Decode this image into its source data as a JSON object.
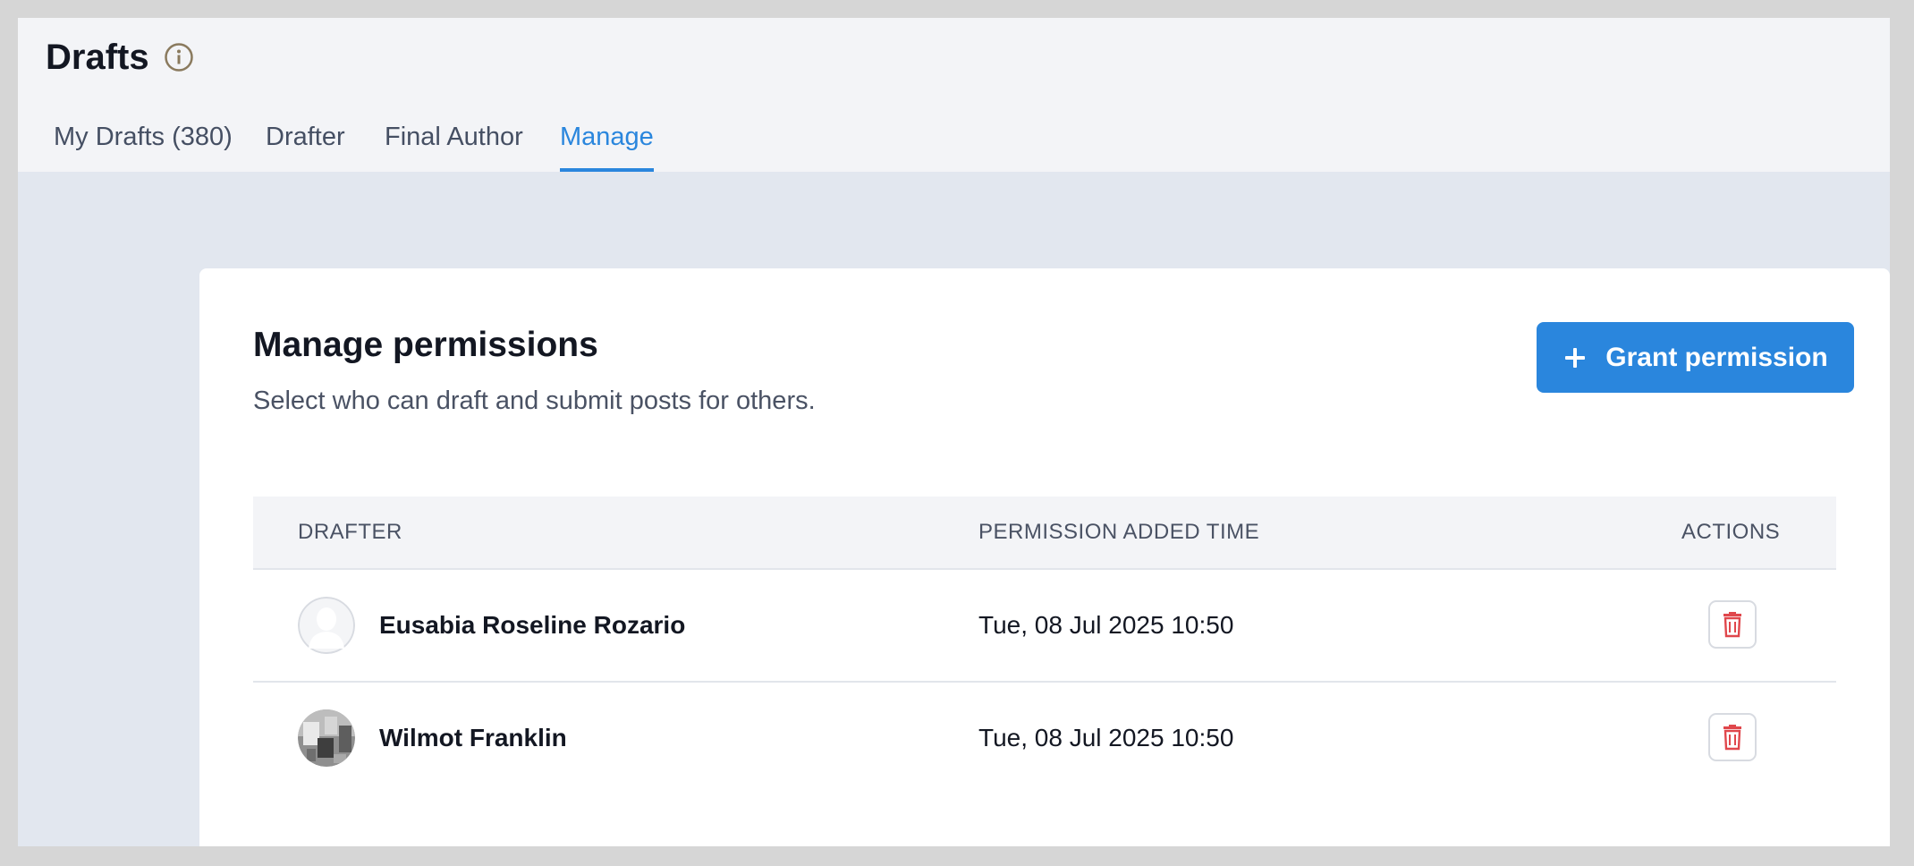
{
  "header": {
    "title": "Drafts",
    "tabs": [
      {
        "label": "My Drafts (380)",
        "active": false
      },
      {
        "label": "Drafter",
        "active": false
      },
      {
        "label": "Final Author",
        "active": false
      },
      {
        "label": "Manage",
        "active": true
      }
    ]
  },
  "card": {
    "title": "Manage permissions",
    "subtitle": "Select who can draft and submit posts for others.",
    "grant_button_label": "Grant permission"
  },
  "table": {
    "columns": [
      "DRAFTER",
      "PERMISSION ADDED TIME",
      "ACTIONS"
    ],
    "rows": [
      {
        "name": "Eusabia Roseline Rozario",
        "time": "Tue, 08 Jul 2025 10:50",
        "avatar": "placeholder-avatar"
      },
      {
        "name": "Wilmot Franklin",
        "time": "Tue, 08 Jul 2025 10:50",
        "avatar": "photo-avatar"
      }
    ]
  },
  "icons": {
    "info": "info-icon",
    "plus": "plus-icon",
    "delete": "trash-icon"
  },
  "colors": {
    "accent": "#2a86dd",
    "danger": "#e0474c",
    "background": "#e2e7ef"
  }
}
